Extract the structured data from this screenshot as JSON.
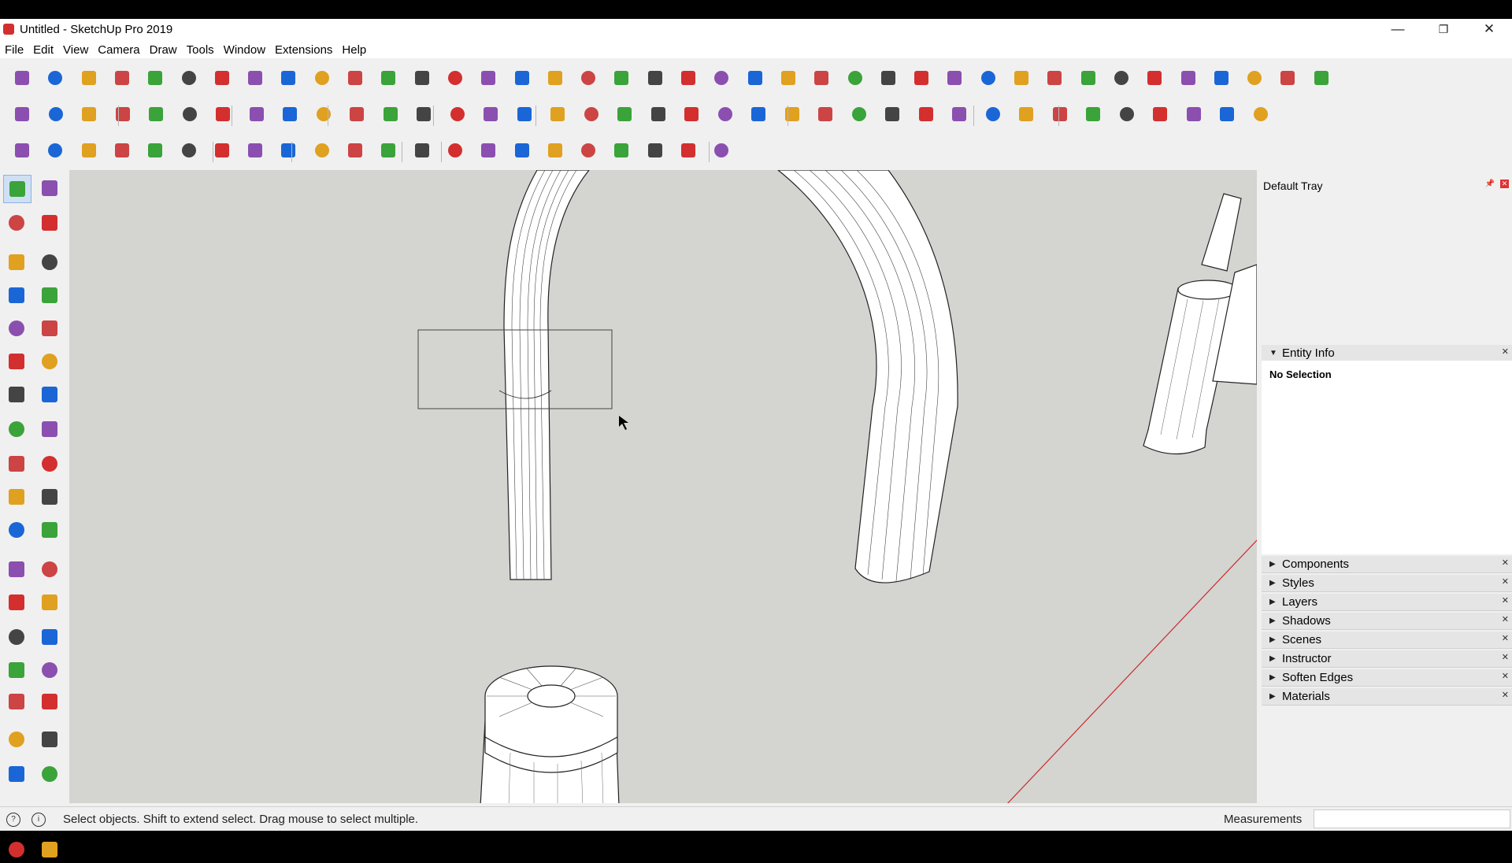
{
  "window": {
    "title": "Untitled - SketchUp Pro 2019",
    "minimize": "—",
    "restore": "❐",
    "close": "✕"
  },
  "menu": [
    "File",
    "Edit",
    "View",
    "Camera",
    "Draw",
    "Tools",
    "Window",
    "Extensions",
    "Help"
  ],
  "colors": {
    "viewport_bg": "#d4d4d1",
    "toolbar_bg": "#f0f0f0",
    "accent_red": "#d32f2f",
    "accent_blue": "#1a66d6",
    "accent_green": "#3aa33a",
    "axis_red": "#cc2b2b"
  },
  "tray": {
    "title": "Default Tray",
    "entity_info": {
      "label": "Entity Info",
      "value": "No Selection"
    },
    "panels": [
      "Components",
      "Styles",
      "Layers",
      "Shadows",
      "Scenes",
      "Instructor",
      "Soften Edges",
      "Materials"
    ]
  },
  "status": {
    "message": "Select objects. Shift to extend select. Drag mouse to select multiple.",
    "measurements_label": "Measurements",
    "measurements_value": ""
  },
  "icons": {
    "toolbar_row1": [
      "paint-bucket-icon",
      "axes-icon",
      "tag-icon",
      "section-icon",
      "eraser-icon",
      "follow-me-icon"
    ],
    "toolbar_row2": [
      "select-icon",
      "component-icon",
      "align-icon",
      "grid-icon",
      "texture-icon",
      "push-pull-icon"
    ],
    "toolbar_row3": [
      "building-icon",
      "home-icon",
      "camera-icon",
      "move-icon",
      "rotate-icon",
      "scale-icon",
      "help-icon",
      "style-icon",
      "shadow-icon",
      "pulley-icon"
    ],
    "left_tools": [
      "select-icon",
      "component-icon",
      "paint-icon",
      "eraser-icon",
      "line-icon",
      "freehand-icon",
      "rectangle-icon",
      "rotated-rectangle-icon",
      "circle-icon",
      "polygon-icon",
      "arc-icon",
      "2pt-arc-icon",
      "3pt-arc-icon",
      "pie-icon",
      "move-icon",
      "push-pull-icon",
      "rotate-icon",
      "follow-me-icon",
      "scale-icon",
      "offset-icon",
      "tape-measure-icon",
      "dimension-icon",
      "protractor-icon",
      "text-icon",
      "axes-icon",
      "3d-text-icon",
      "orbit-icon",
      "pan-icon",
      "zoom-icon",
      "zoom-window-icon",
      "zoom-extents-icon",
      "previous-icon",
      "position-camera-icon",
      "look-around-icon",
      "walk-icon",
      "section-plane-icon"
    ]
  }
}
